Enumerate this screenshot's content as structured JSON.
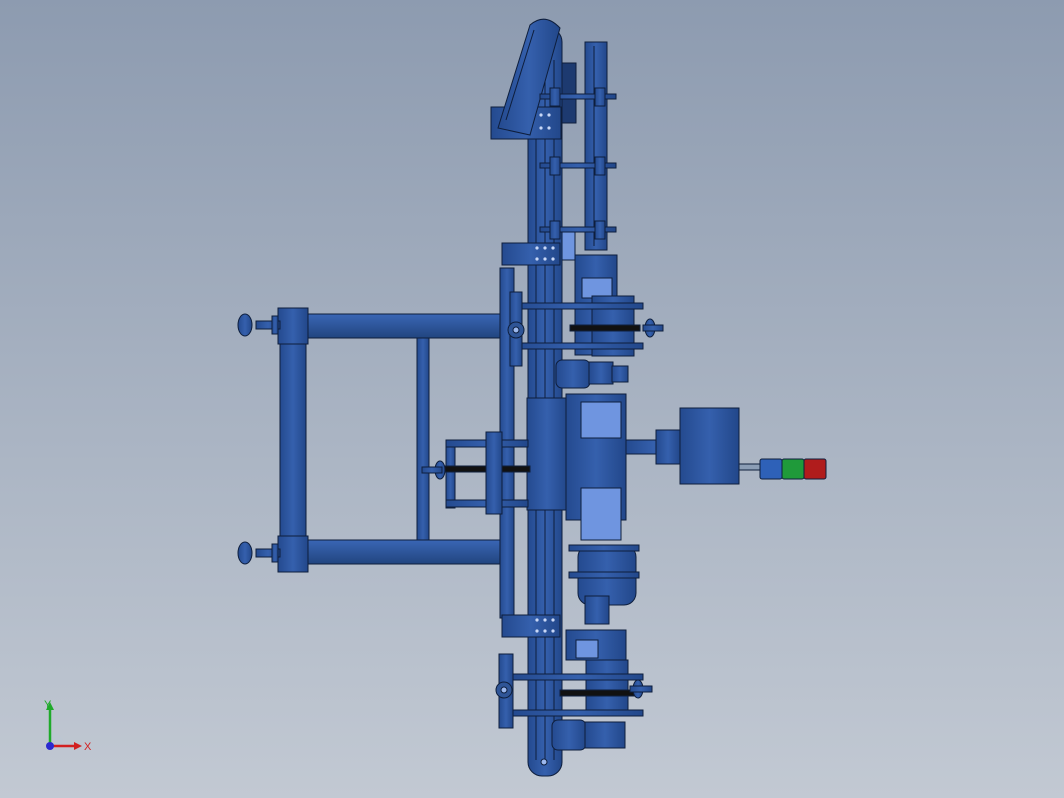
{
  "viewport": {
    "background_top": "#8d9bb0",
    "background_bottom": "#c2c9d3",
    "model_color": "#2f5597",
    "model_dark": "#1d3a70",
    "model_light": "#6f95e0",
    "belt_color": "#111111"
  },
  "signal_tower": {
    "colors": [
      "#2e61b8",
      "#1f9a3a",
      "#b01c1c"
    ]
  },
  "triad": {
    "x_label": "X",
    "y_label": "Y",
    "x_color": "#d22020",
    "y_color": "#1faa2a",
    "z_color": "#2a2ad0"
  }
}
